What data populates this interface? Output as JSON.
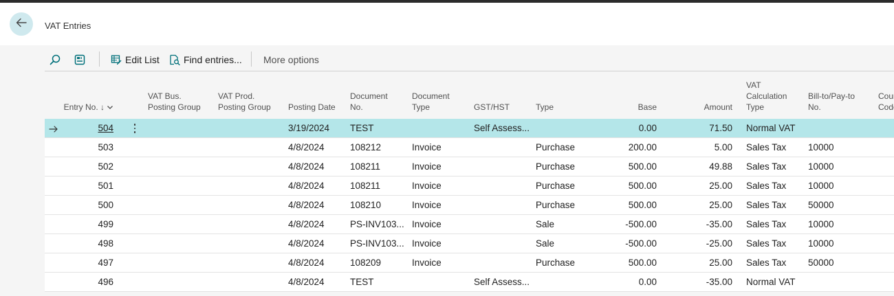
{
  "page": {
    "title": "VAT Entries"
  },
  "toolbar": {
    "edit_list": "Edit List",
    "find_entries": "Find entries...",
    "more_options": "More options",
    "icons": [
      "search-icon",
      "show-as-tiles-icon",
      "edit-list-icon",
      "find-entries-icon"
    ]
  },
  "table": {
    "columns": [
      {
        "key": "entry_no",
        "lines": [
          "Entry No. ↓"
        ]
      },
      {
        "key": "vat_bus",
        "lines": [
          "VAT Bus.",
          "Posting Group"
        ]
      },
      {
        "key": "vat_prod",
        "lines": [
          "VAT Prod.",
          "Posting Group"
        ]
      },
      {
        "key": "posting_date",
        "lines": [
          "Posting Date"
        ]
      },
      {
        "key": "document_no",
        "lines": [
          "Document",
          "No."
        ]
      },
      {
        "key": "document_type",
        "lines": [
          "Document",
          "Type"
        ]
      },
      {
        "key": "gst_hst",
        "lines": [
          "GST/HST"
        ]
      },
      {
        "key": "type",
        "lines": [
          "Type"
        ]
      },
      {
        "key": "base",
        "lines": [
          "Base"
        ]
      },
      {
        "key": "amount",
        "lines": [
          "Amount"
        ]
      },
      {
        "key": "vat_calc_type",
        "lines": [
          "VAT",
          "Calculation",
          "Type"
        ]
      },
      {
        "key": "bill_to",
        "lines": [
          "Bill-to/Pay-to",
          "No."
        ]
      },
      {
        "key": "country",
        "lines": [
          "Coun",
          "Code"
        ]
      }
    ],
    "rows": [
      {
        "entry_no": "504",
        "vat_bus": "",
        "vat_prod": "",
        "posting_date": "3/19/2024",
        "document_no": "TEST",
        "document_type": "",
        "gst_hst": "Self Assess...",
        "type": "",
        "base": "0.00",
        "amount": "71.50",
        "vat_calc_type": "Normal VAT",
        "bill_to": "",
        "country": "",
        "selected": true
      },
      {
        "entry_no": "503",
        "vat_bus": "",
        "vat_prod": "",
        "posting_date": "4/8/2024",
        "document_no": "108212",
        "document_type": "Invoice",
        "gst_hst": "",
        "type": "Purchase",
        "base": "200.00",
        "amount": "5.00",
        "vat_calc_type": "Sales Tax",
        "bill_to": "10000",
        "country": ""
      },
      {
        "entry_no": "502",
        "vat_bus": "",
        "vat_prod": "",
        "posting_date": "4/8/2024",
        "document_no": "108211",
        "document_type": "Invoice",
        "gst_hst": "",
        "type": "Purchase",
        "base": "500.00",
        "amount": "49.88",
        "vat_calc_type": "Sales Tax",
        "bill_to": "10000",
        "country": ""
      },
      {
        "entry_no": "501",
        "vat_bus": "",
        "vat_prod": "",
        "posting_date": "4/8/2024",
        "document_no": "108211",
        "document_type": "Invoice",
        "gst_hst": "",
        "type": "Purchase",
        "base": "500.00",
        "amount": "25.00",
        "vat_calc_type": "Sales Tax",
        "bill_to": "10000",
        "country": ""
      },
      {
        "entry_no": "500",
        "vat_bus": "",
        "vat_prod": "",
        "posting_date": "4/8/2024",
        "document_no": "108210",
        "document_type": "Invoice",
        "gst_hst": "",
        "type": "Purchase",
        "base": "500.00",
        "amount": "25.00",
        "vat_calc_type": "Sales Tax",
        "bill_to": "50000",
        "country": ""
      },
      {
        "entry_no": "499",
        "vat_bus": "",
        "vat_prod": "",
        "posting_date": "4/8/2024",
        "document_no": "PS-INV103...",
        "document_type": "Invoice",
        "gst_hst": "",
        "type": "Sale",
        "base": "-500.00",
        "amount": "-35.00",
        "vat_calc_type": "Sales Tax",
        "bill_to": "10000",
        "country": ""
      },
      {
        "entry_no": "498",
        "vat_bus": "",
        "vat_prod": "",
        "posting_date": "4/8/2024",
        "document_no": "PS-INV103...",
        "document_type": "Invoice",
        "gst_hst": "",
        "type": "Sale",
        "base": "-500.00",
        "amount": "-25.00",
        "vat_calc_type": "Sales Tax",
        "bill_to": "10000",
        "country": ""
      },
      {
        "entry_no": "497",
        "vat_bus": "",
        "vat_prod": "",
        "posting_date": "4/8/2024",
        "document_no": "108209",
        "document_type": "Invoice",
        "gst_hst": "",
        "type": "Purchase",
        "base": "500.00",
        "amount": "25.00",
        "vat_calc_type": "Sales Tax",
        "bill_to": "50000",
        "country": ""
      },
      {
        "entry_no": "496",
        "vat_bus": "",
        "vat_prod": "",
        "posting_date": "4/8/2024",
        "document_no": "TEST",
        "document_type": "",
        "gst_hst": "Self Assess...",
        "type": "",
        "base": "0.00",
        "amount": "-35.00",
        "vat_calc_type": "Normal VAT",
        "bill_to": "",
        "country": ""
      }
    ]
  },
  "colors": {
    "accent": "#00707a",
    "selected_row": "#b4e6e9",
    "back_button": "#cfe9ee"
  }
}
